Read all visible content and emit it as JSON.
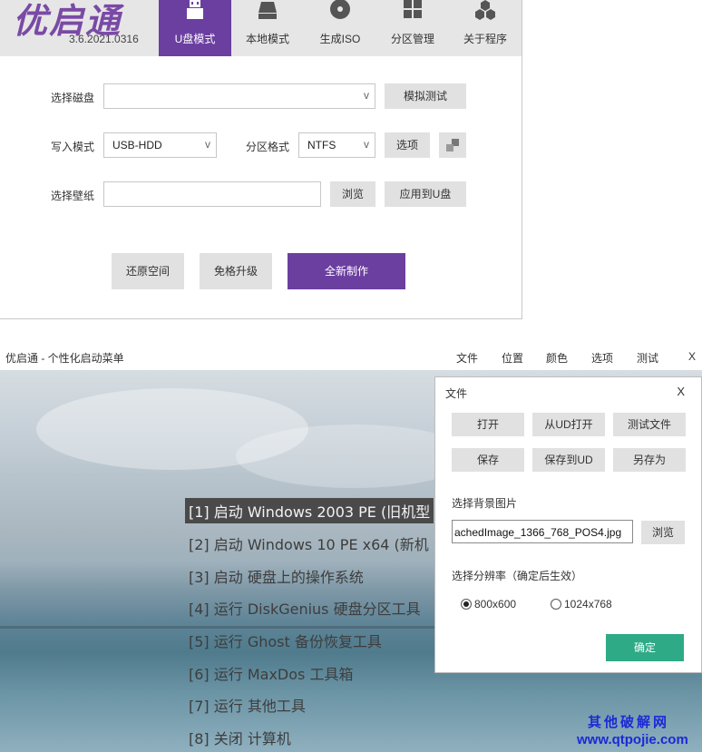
{
  "app": {
    "logo_text": "优启通",
    "version": "3.6.2021.0316",
    "tabs": [
      {
        "label": "U盘模式",
        "icon": "usb-drive-icon",
        "active": true
      },
      {
        "label": "本地模式",
        "icon": "hard-disk-icon",
        "active": false
      },
      {
        "label": "生成ISO",
        "icon": "disc-icon",
        "active": false
      },
      {
        "label": "分区管理",
        "icon": "partition-grid-icon",
        "active": false
      },
      {
        "label": "关于程序",
        "icon": "hexagons-icon",
        "active": false
      }
    ],
    "accent_color": "#6b3fa0"
  },
  "form": {
    "disk_label": "选择磁盘",
    "disk_value": "",
    "disk_arrow": "v",
    "simulate_button": "模拟测试",
    "write_mode_label": "写入模式",
    "write_mode_value": "USB-HDD",
    "write_mode_arrow": "v",
    "partition_format_label": "分区格式",
    "partition_format_value": "NTFS",
    "partition_format_arrow": "v",
    "options_button": "选项",
    "wallpaper_label": "选择壁纸",
    "wallpaper_value": "",
    "browse_button": "浏览",
    "apply_button": "应用到U盘"
  },
  "actions": {
    "restore_space": "还原空间",
    "free_upgrade": "免格升级",
    "new_create": "全新制作"
  },
  "menu_editor": {
    "title": "优启通 - 个性化启动菜单",
    "menus": [
      "文件",
      "位置",
      "颜色",
      "选项",
      "测试",
      "X"
    ],
    "boot_items": [
      "[1] 启动 Windows 2003 PE (旧机型",
      "[2] 启动 Windows 10 PE x64 (新机",
      "[3] 启动 硬盘上的操作系统",
      "[4] 运行 DiskGenius 硬盘分区工具",
      "[5] 运行 Ghost 备份恢复工具",
      "[6] 运行 MaxDos 工具箱",
      "[7] 运行 其他工具",
      "[8] 关闭 计算机"
    ],
    "selected_index": 0
  },
  "file_dialog": {
    "title": "文件",
    "close": "X",
    "buttons": [
      "打开",
      "从UD打开",
      "测试文件",
      "保存",
      "保存到UD",
      "另存为"
    ],
    "bg_section": "选择背景图片",
    "bg_path": "achedImage_1366_768_POS4.jpg",
    "bg_browse": "浏览",
    "resolution_section": "选择分辨率（确定后生效）",
    "resolutions": [
      {
        "label": "800x600",
        "selected": true
      },
      {
        "label": "1024x768",
        "selected": false
      }
    ],
    "ok_button": "确定",
    "ok_color": "#2eaa86"
  },
  "watermark": {
    "line1": "其他破解网",
    "line2": "www.qtpojie.com"
  }
}
